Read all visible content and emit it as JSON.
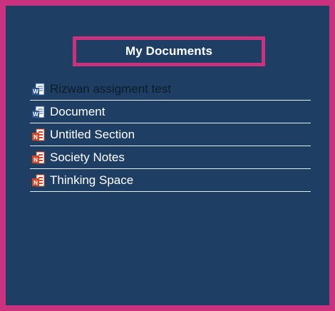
{
  "panel": {
    "title": "My Documents"
  },
  "documents": [
    {
      "label": "Rizwan assigment test",
      "icon": "word-doc-icon",
      "dim": true
    },
    {
      "label": "Document",
      "icon": "word-doc-icon",
      "dim": false
    },
    {
      "label": "Untitled Section",
      "icon": "onenote-icon",
      "dim": false
    },
    {
      "label": "Society Notes",
      "icon": "onenote-icon",
      "dim": false
    },
    {
      "label": "Thinking Space",
      "icon": "onenote-icon",
      "dim": false
    }
  ],
  "colors": {
    "background": "#1e3f63",
    "border_accent": "#c8327f",
    "word_blue": "#2b5797",
    "onenote_orange": "#d24726"
  }
}
